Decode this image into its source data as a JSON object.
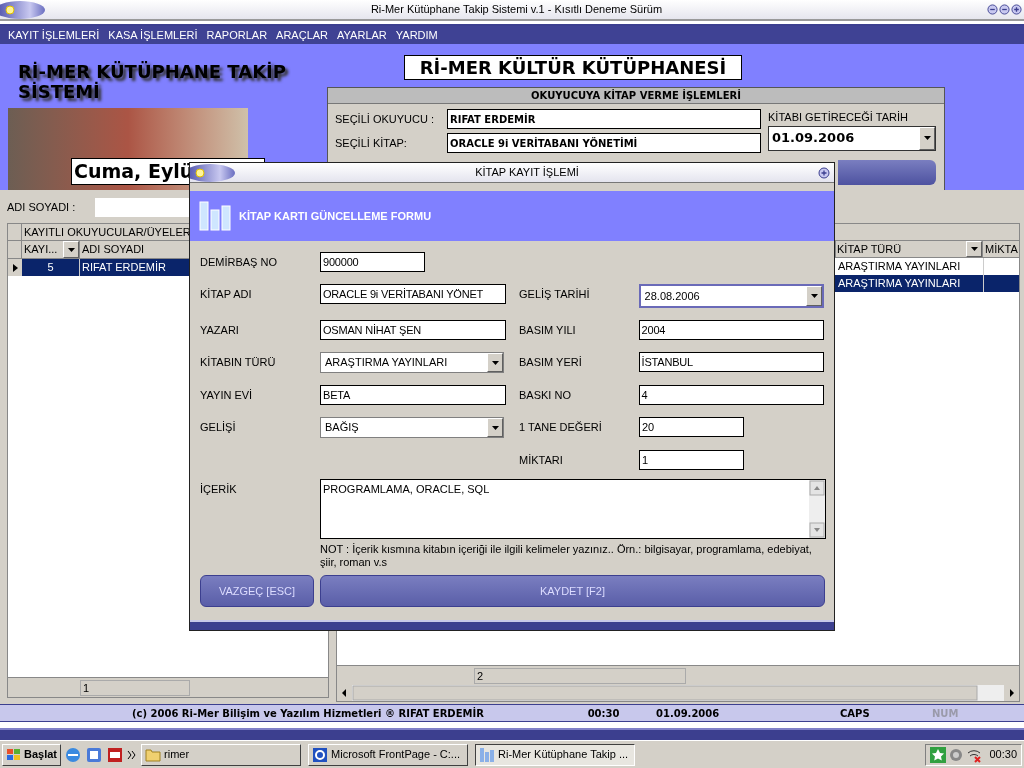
{
  "window": {
    "title": "Ri-Mer Kütüphane Takip Sistemi v.1 - Kısıtlı Deneme Sürüm"
  },
  "menu": [
    {
      "label": "KAYIT İŞLEMLERİ"
    },
    {
      "label": "KASA İŞLEMLERİ"
    },
    {
      "label": "RAPORLAR"
    },
    {
      "label": "ARAÇLAR"
    },
    {
      "label": "AYARLAR"
    },
    {
      "label": "YARDIM"
    }
  ],
  "header": {
    "app_title": "Rİ-MER KÜTÜPHANE TAKİP SİSTEMİ",
    "date": "Cuma, Eylü",
    "library_name": "Rİ-MER KÜLTÜR KÜTÜPHANESİ"
  },
  "lending_panel": {
    "title": "OKUYUCUYA KİTAP VERME İŞLEMLERİ",
    "fields": [
      {
        "label": "SEÇİLİ OKUYUCU :",
        "value": "RIFAT ERDEMİR"
      },
      {
        "label": "SEÇİLİ KİTAP:",
        "value": "ORACLE 9i VERİTABANI YÖNETİMİ"
      }
    ],
    "due_date": {
      "label": "KİTABI GETİRECEĞİ TARİH",
      "value": "01.09.2006"
    }
  },
  "member_search": {
    "label": "ADI SOYADI :"
  },
  "members_grid": {
    "title": "KAYITLI OKUYUCULAR/ÜYELER",
    "columns": [
      "KAYI...",
      "ADI SOYADI"
    ],
    "rows": [
      {
        "cells": [
          "5",
          "RIFAT ERDEMİR"
        ],
        "selected": true
      }
    ],
    "footer": "1"
  },
  "books_grid": {
    "columns": [
      "KİTAP TÜRÜ",
      "MİKTA"
    ],
    "rows": [
      {
        "cells": [
          "ARAŞTIRMA YAYINLARI"
        ],
        "selected": false
      },
      {
        "cells": [
          "ARAŞTIRMA YAYINLARI"
        ],
        "selected": true
      }
    ],
    "footer": "2"
  },
  "dialog": {
    "title": "KİTAP KAYIT İŞLEMİ",
    "form_title": "KİTAP KARTI GÜNCELLEME FORMU",
    "rows": [
      {
        "left": {
          "label": "DEMİRBAŞ NO",
          "value": "900000",
          "kind": "short_text"
        }
      },
      {
        "left": {
          "label": "KİTAP ADI",
          "value": "ORACLE 9i VERİTABANI YÖNET",
          "kind": "text"
        },
        "right": {
          "label": "GELİŞ TARİHİ",
          "value": "28.08.2006",
          "kind": "date"
        }
      },
      {
        "left": {
          "label": "YAZARI",
          "value": "OSMAN NİHAT ŞEN",
          "kind": "text"
        },
        "right": {
          "label": "BASIM YILI",
          "value": "2004",
          "kind": "text"
        }
      },
      {
        "left": {
          "label": "KİTABIN TÜRÜ",
          "value": "ARAŞTIRMA YAYINLARI",
          "kind": "select"
        },
        "right": {
          "label": "BASIM YERİ",
          "value": "İSTANBUL",
          "kind": "text"
        }
      },
      {
        "left": {
          "label": "YAYIN EVİ",
          "value": "BETA",
          "kind": "text"
        },
        "right": {
          "label": "BASKI NO",
          "value": "4",
          "kind": "text"
        }
      },
      {
        "left": {
          "label": "GELİŞİ",
          "value": "BAĞIŞ",
          "kind": "select"
        },
        "right": {
          "label": "1 TANE DEĞERİ",
          "value": "20",
          "kind": "short_text"
        }
      },
      {
        "right": {
          "label": "MİKTARI",
          "value": "1",
          "kind": "short_text"
        }
      }
    ],
    "content": {
      "label": "İÇERİK",
      "value": "PROGRAMLAMA, ORACLE, SQL"
    },
    "note": "NOT : İçerik kısmına kitabın içeriği ile ilgili kelimeler yazınız.. Örn.: bilgisayar, programlama, edebiyat, şiir, roman v.s",
    "buttons": [
      {
        "label": "VAZGEÇ [ESC]"
      },
      {
        "label": "KAYDET [F2]"
      }
    ]
  },
  "status_bar": {
    "copyright": "(c) 2006 Ri-Mer Bilişim ve Yazılım Hizmetleri ® RIFAT ERDEMİR",
    "time": "00:30",
    "date": "01.09.2006",
    "indicators": [
      {
        "label": "CAPS",
        "on": true
      },
      {
        "label": "NUM",
        "on": false
      }
    ]
  },
  "taskbar": {
    "start": "Başlat",
    "tasks": [
      {
        "label": "rimer",
        "kind": "folder",
        "selected": false
      },
      {
        "label": "Microsoft FrontPage - C:...",
        "kind": "frontpage",
        "selected": false
      },
      {
        "label": "Ri-Mer Kütüphane Takip ...",
        "kind": "app",
        "selected": true
      }
    ],
    "clock": "00:30"
  }
}
